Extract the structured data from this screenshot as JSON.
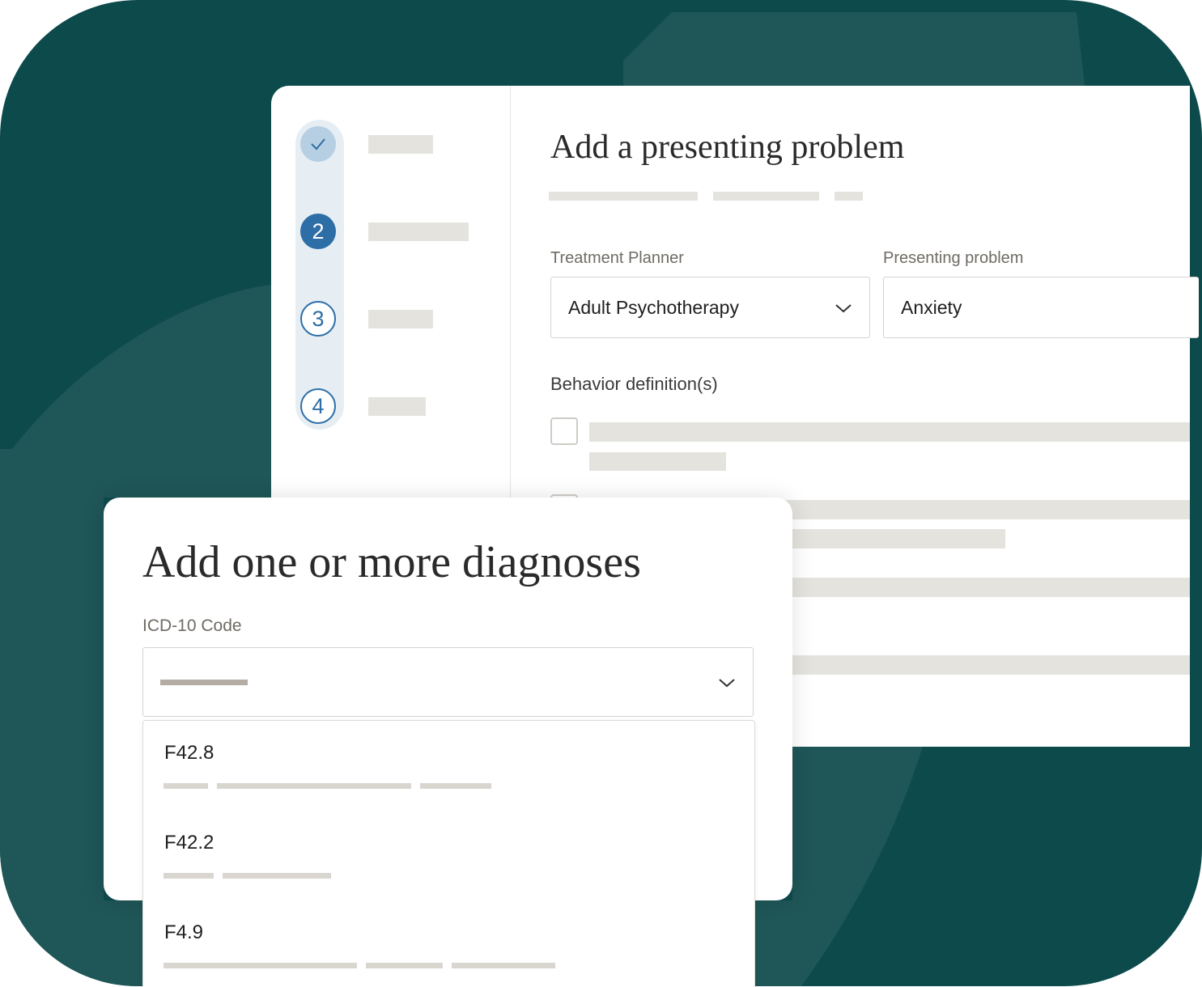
{
  "presenting_problem_form": {
    "title": "Add a presenting problem",
    "treatment_planner": {
      "label": "Treatment Planner",
      "value": "Adult Psychotherapy"
    },
    "presenting_problem": {
      "label": "Presenting problem",
      "value": "Anxiety"
    },
    "behavior_definitions_label": "Behavior definition(s)"
  },
  "stepper": {
    "steps": [
      {
        "number": "",
        "state": "complete",
        "icon": "check-icon"
      },
      {
        "number": "2",
        "state": "active"
      },
      {
        "number": "3",
        "state": "pending"
      },
      {
        "number": "4",
        "state": "pending"
      }
    ]
  },
  "diagnosis_form": {
    "title": "Add one or more diagnoses",
    "icd_label": "ICD-10 Code",
    "options": [
      {
        "code": "F42.8"
      },
      {
        "code": "F42.2"
      },
      {
        "code": "F4.9"
      }
    ]
  },
  "colors": {
    "background": "#0d4a4c",
    "accent_blue": "#2d6ea6",
    "placeholder": "#e5e3de"
  }
}
